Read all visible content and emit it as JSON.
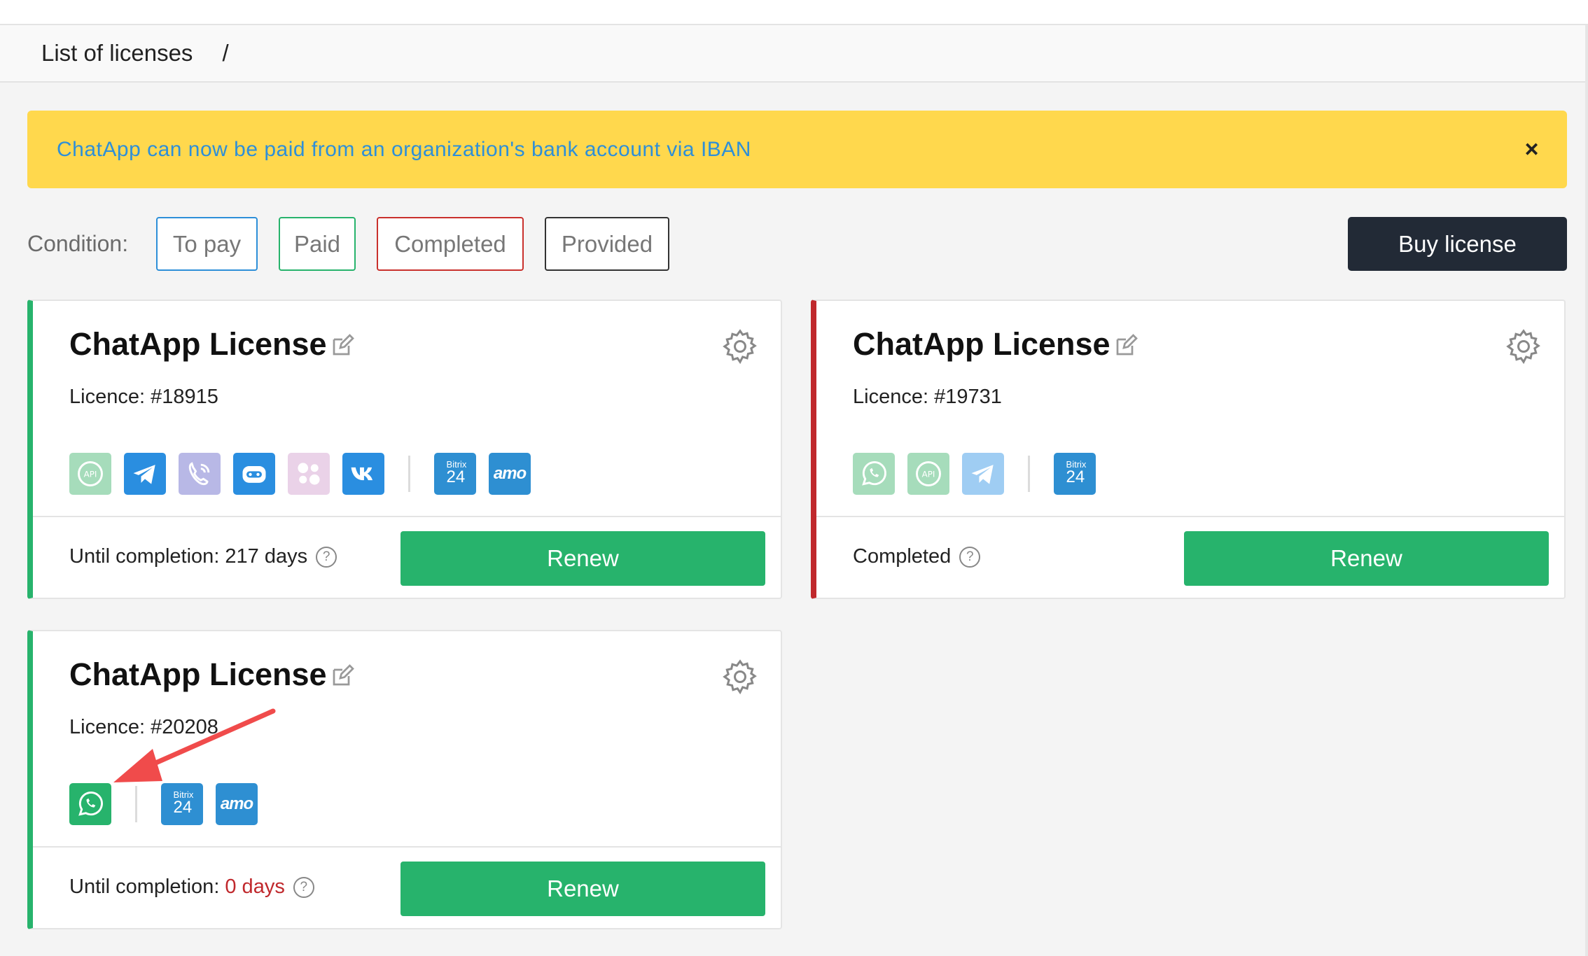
{
  "breadcrumb": {
    "title": "List of licenses",
    "separator": "/"
  },
  "banner": {
    "text": "ChatApp can now be paid from an organization's bank account via IBAN",
    "close_label": "×"
  },
  "filters": {
    "label": "Condition:",
    "items": [
      {
        "label": "To pay",
        "color": "#2d8fd8"
      },
      {
        "label": "Paid",
        "color": "#27b36c"
      },
      {
        "label": "Completed",
        "color": "#c9302c"
      },
      {
        "label": "Provided",
        "color": "#333333"
      }
    ]
  },
  "buy_button": {
    "label": "Buy license"
  },
  "cards": [
    {
      "title": "ChatApp License",
      "licence": "Licence: #18915",
      "accent": "#27b36c",
      "channels": [
        "whatsapp-api-icon",
        "telegram-icon",
        "viber-icon",
        "chatbot-icon",
        "instagram-icon",
        "vk-icon"
      ],
      "integrations": [
        "bitrix24-icon",
        "amocrm-icon"
      ],
      "status": "Until completion: 217 days",
      "renew_label": "Renew"
    },
    {
      "title": "ChatApp License",
      "licence": "Licence: #19731",
      "accent": "#c0282c",
      "channels": [
        "whatsapp-icon",
        "whatsapp-api-icon",
        "telegram-icon"
      ],
      "integrations": [
        "bitrix24-icon"
      ],
      "status": "Completed",
      "renew_label": "Renew"
    },
    {
      "title": "ChatApp License",
      "licence": "Licence: #20208",
      "accent": "#27b36c",
      "channels": [
        "whatsapp-icon"
      ],
      "integrations": [
        "bitrix24-icon",
        "amocrm-icon"
      ],
      "status_prefix": "Until completion:",
      "status_days": "0 days",
      "renew_label": "Renew"
    }
  ],
  "bitrix_icon": {
    "top": "Bitrix",
    "num": "24"
  },
  "amo_icon": {
    "text": "amo"
  },
  "help_icon": {
    "glyph": "?"
  }
}
